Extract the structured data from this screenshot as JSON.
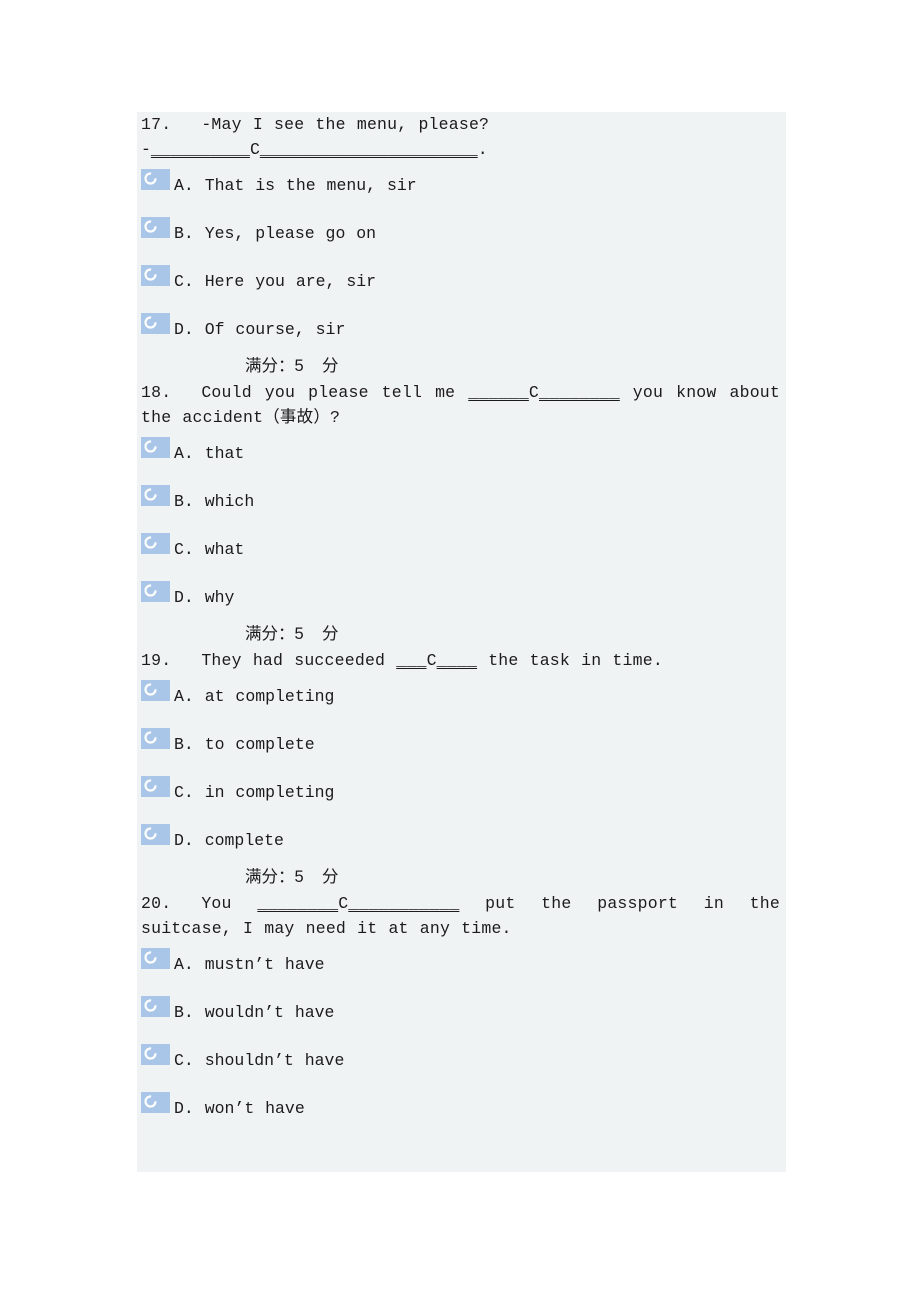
{
  "page": {
    "background_color": "#ffffff",
    "panel_color": "#f0f3f4",
    "accent_color": "#a9c6e8",
    "text_color": "#1b1b1b"
  },
  "questions": [
    {
      "number": "17.",
      "stem_line1": "-May I see the menu, please?",
      "stem_line2_prefix": "-",
      "stem_line2_blank_before": "__________",
      "stem_line2_answer": "C",
      "stem_line2_blank_after": "______________________",
      "stem_line2_suffix": ".",
      "options": [
        {
          "letter": "A.",
          "text": "That is the menu, sir"
        },
        {
          "letter": "B.",
          "text": "Yes, please go on"
        },
        {
          "letter": "C.",
          "text": "Here you are, sir"
        },
        {
          "letter": "D.",
          "text": "Of course, sir"
        }
      ],
      "score_label": "满分：5    分"
    },
    {
      "number": "18.",
      "stem_before": "Could you please tell me ",
      "stem_blank_before": "______",
      "stem_answer": "C",
      "stem_blank_after": "________",
      "stem_after": " you know about the accident（事故）?",
      "options": [
        {
          "letter": "A.",
          "text": "that"
        },
        {
          "letter": "B.",
          "text": "which"
        },
        {
          "letter": "C.",
          "text": "what"
        },
        {
          "letter": "D.",
          "text": "why"
        }
      ],
      "score_label": "满分：5    分"
    },
    {
      "number": "19.",
      "stem_before": "They had succeeded ",
      "stem_blank_before": "___",
      "stem_answer": "C",
      "stem_blank_after": "____",
      "stem_after": " the task in time.",
      "options": [
        {
          "letter": "A.",
          "text": "at completing"
        },
        {
          "letter": "B.",
          "text": "to complete"
        },
        {
          "letter": "C.",
          "text": "in completing"
        },
        {
          "letter": "D.",
          "text": "complete"
        }
      ],
      "score_label": "满分：5    分"
    },
    {
      "number": "20.",
      "stem_before": "You ",
      "stem_blank_before": "________",
      "stem_answer": "C",
      "stem_blank_after": "___________",
      "stem_after": " put the passport in the suitcase, I may need it at any time.",
      "options": [
        {
          "letter": "A.",
          "text": "mustn’t have"
        },
        {
          "letter": "B.",
          "text": "wouldn’t have"
        },
        {
          "letter": "C.",
          "text": "shouldn’t have"
        },
        {
          "letter": "D.",
          "text": "won’t have"
        }
      ]
    }
  ],
  "icons": {
    "radio_placeholder": "broken-image-radio-icon"
  }
}
